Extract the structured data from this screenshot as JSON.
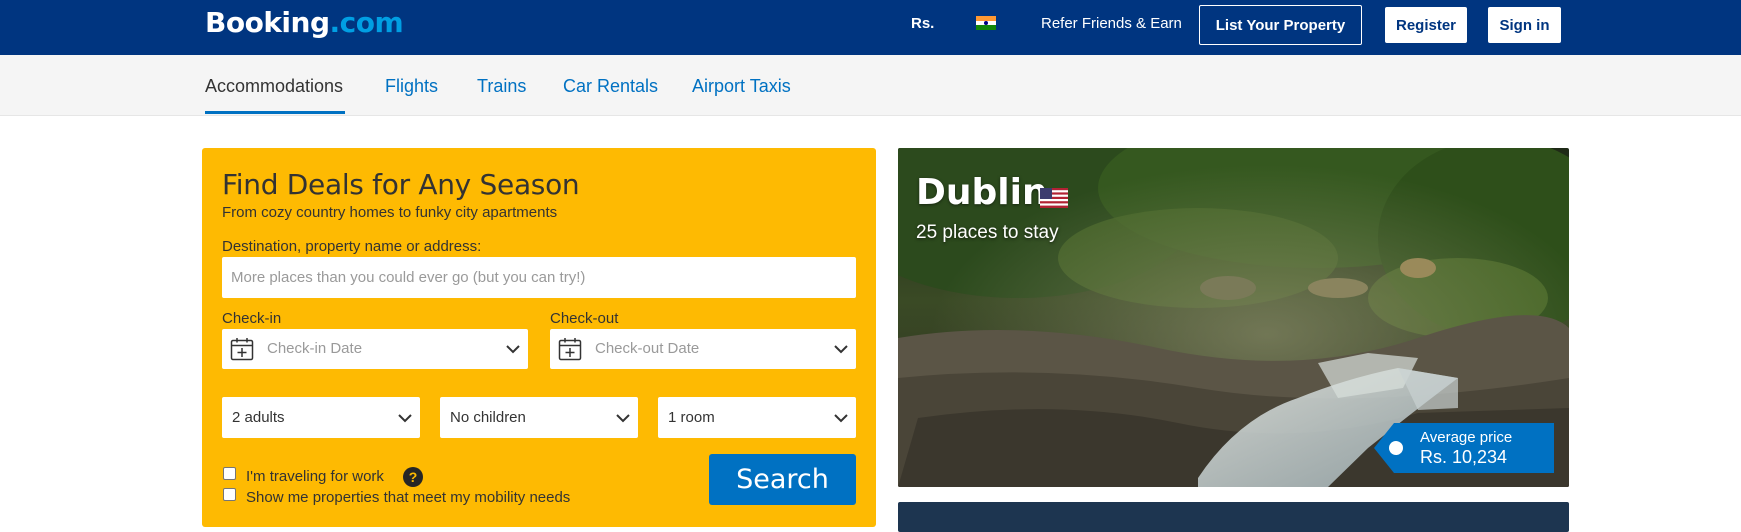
{
  "header": {
    "logo_main": "Booking",
    "logo_suffix": ".com",
    "currency": "Rs.",
    "flag_icon": "india-flag-icon",
    "refer": "Refer Friends & Earn",
    "list_property": "List Your Property",
    "register": "Register",
    "sign_in": "Sign in"
  },
  "subnav": {
    "tabs": [
      {
        "label": "Accommodations",
        "active": true
      },
      {
        "label": "Flights",
        "active": false
      },
      {
        "label": "Trains",
        "active": false
      },
      {
        "label": "Car Rentals",
        "active": false
      },
      {
        "label": "Airport Taxis",
        "active": false
      }
    ]
  },
  "search": {
    "title": "Find Deals for Any Season",
    "subtitle": "From cozy country homes to funky city apartments",
    "destination_label": "Destination, property name or address:",
    "destination_placeholder": "More places than you could ever go (but you can try!)",
    "checkin_label": "Check-in",
    "checkin_placeholder": "Check-in Date",
    "checkout_label": "Check-out",
    "checkout_placeholder": "Check-out Date",
    "adults": "2 adults",
    "children": "No children",
    "rooms": "1 room",
    "work_label": "I'm traveling for work",
    "mobility_label": "Show me properties that meet my mobility needs",
    "help_glyph": "?",
    "search_button": "Search"
  },
  "destination_card": {
    "city": "Dublin",
    "flag_icon": "usa-flag-icon",
    "places": "25 places to stay",
    "price_label": "Average price",
    "price_value": "Rs. 10,234"
  },
  "colors": {
    "brand_dark": "#003580",
    "link_blue": "#0071c2",
    "search_panel": "#feba02"
  }
}
